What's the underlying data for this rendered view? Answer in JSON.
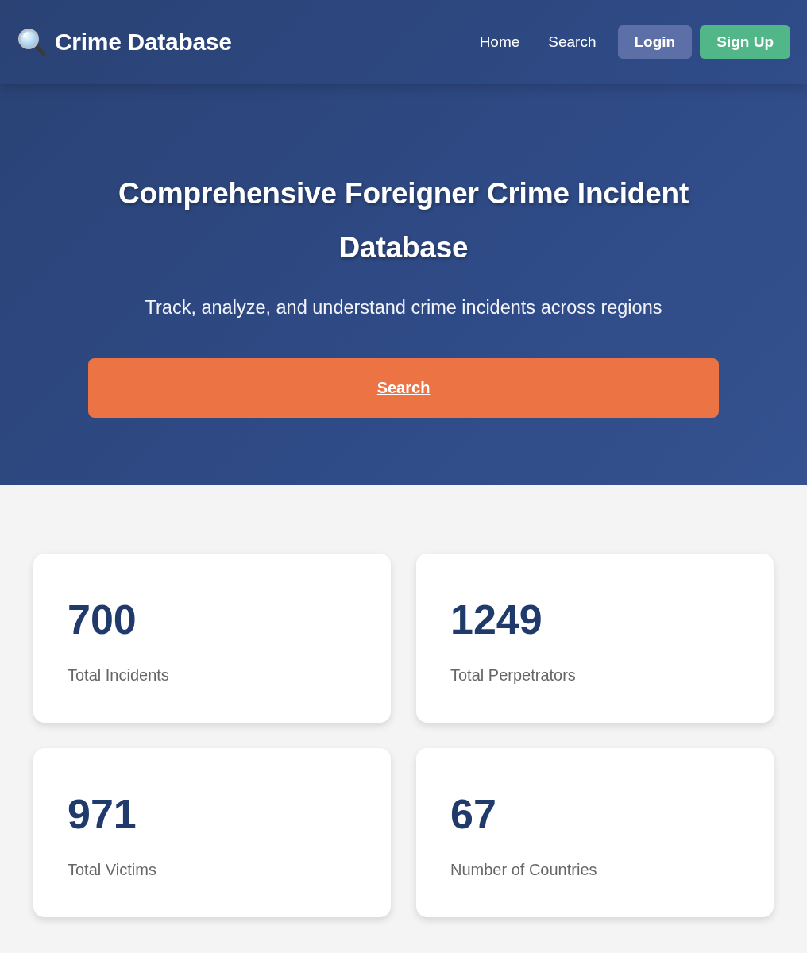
{
  "header": {
    "logo_text": "Crime Database",
    "nav_links": [
      "Home",
      "Search"
    ],
    "buttons": [
      {
        "label": "Login",
        "kind": "secondary"
      },
      {
        "label": "Sign Up",
        "kind": "primary"
      }
    ]
  },
  "hero": {
    "title": "Comprehensive Foreigner Crime Incident Database",
    "subtitle": "Track, analyze, and understand crime incidents across regions",
    "search_button": "Search"
  },
  "stats": [
    {
      "value": "700",
      "label": "Total Incidents"
    },
    {
      "value": "1249",
      "label": "Total Perpetrators"
    },
    {
      "value": "971",
      "label": "Total Victims"
    },
    {
      "value": "67",
      "label": "Number of Countries"
    }
  ]
}
